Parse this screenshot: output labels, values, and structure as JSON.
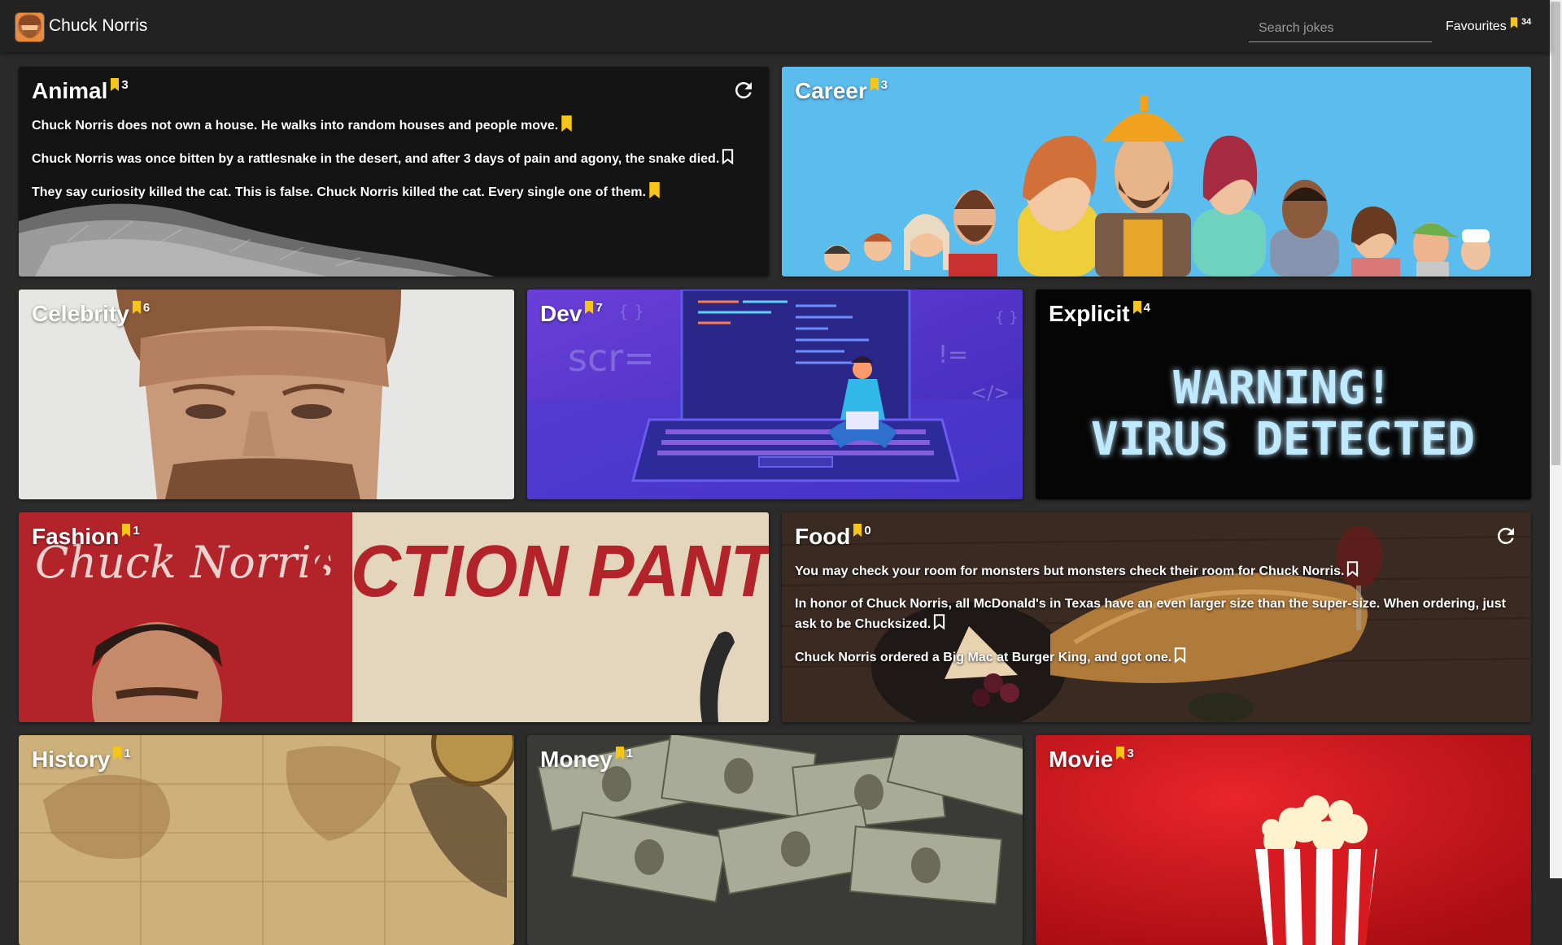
{
  "app": {
    "title": "Chuck Norris"
  },
  "search": {
    "placeholder": "Search jokes",
    "value": ""
  },
  "favourites": {
    "label": "Favourites",
    "count": "34"
  },
  "colors": {
    "accent": "#f5c518",
    "header_bg": "#222222",
    "page_bg": "#2b2b2b"
  },
  "cards": {
    "animal": {
      "name": "Animal",
      "count": "3",
      "jokes": [
        {
          "text": "Chuck Norris does not own a house. He walks into random houses and people move.",
          "favourited": true
        },
        {
          "text": "Chuck Norris was once bitten by a rattlesnake in the desert, and after 3 days of pain and agony, the snake died.",
          "favourited": false
        },
        {
          "text": "They say curiosity killed the cat. This is false. Chuck Norris killed the cat. Every single one of them.",
          "favourited": true
        }
      ]
    },
    "career": {
      "name": "Career",
      "count": "3"
    },
    "celebrity": {
      "name": "Celebrity",
      "count": "6"
    },
    "dev": {
      "name": "Dev",
      "count": "7",
      "art_text": [
        "scr=",
        "{ }",
        "!=",
        "</>",
        "{ }"
      ]
    },
    "explicit": {
      "name": "Explicit",
      "count": "4",
      "art_line1": "WARNING!",
      "art_line2": "VIRUS DETECTED"
    },
    "fashion": {
      "name": "Fashion",
      "count": "1",
      "art_signature": "Chuck Norris",
      "art_banner": "ACTION PANTS"
    },
    "food": {
      "name": "Food",
      "count": "0",
      "jokes": [
        {
          "text": "You may check your room for monsters but monsters check their room for Chuck Norris.",
          "favourited": false
        },
        {
          "text": "In honor of Chuck Norris, all McDonald's in Texas have an even larger size than the super-size. When ordering, just ask to be Chucksized.",
          "favourited": false
        },
        {
          "text": "Chuck Norris ordered a Big Mac at Burger King, and got one.",
          "favourited": false
        }
      ]
    },
    "history": {
      "name": "History",
      "count": "1"
    },
    "money": {
      "name": "Money",
      "count": "1"
    },
    "movie": {
      "name": "Movie",
      "count": "3"
    }
  }
}
